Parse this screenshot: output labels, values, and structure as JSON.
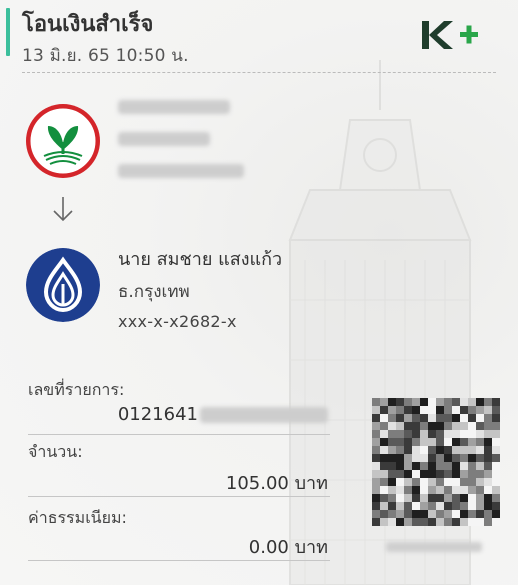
{
  "header": {
    "title": "โอนเงินสำเร็จ",
    "datetime": "13 มิ.ย. 65  10:50 น.",
    "logo_icon": "kplus-logo-icon",
    "accent_color": "#3cbf9c"
  },
  "sender": {
    "bank_icon": "kbank-logo-icon"
  },
  "receiver": {
    "name": "นาย สมชาย แสงแก้ว",
    "bank": "ธ.กรุงเทพ",
    "account": "xxx-x-x2682-x",
    "bank_icon": "bbl-logo-icon"
  },
  "details": {
    "ref_label": "เลขที่รายการ:",
    "ref_value": "0121641",
    "amount_label": "จำนวน:",
    "amount_value": "105.00 บาท",
    "fee_label": "ค่าธรรมเนียม:",
    "fee_value": "0.00 บาท"
  },
  "qr": {
    "icon": "qr-code-icon"
  }
}
